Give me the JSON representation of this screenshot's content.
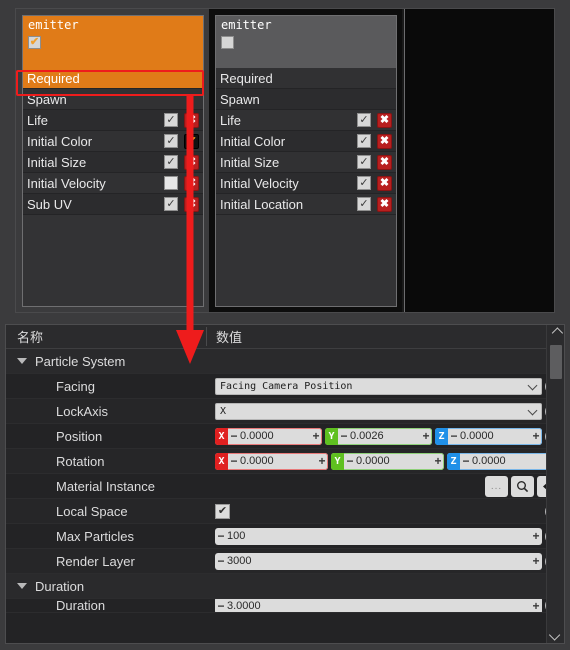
{
  "emitters": [
    {
      "title": "emitter",
      "enabled": true,
      "selected": true,
      "modules": [
        {
          "label": "Required",
          "type": "header-selected",
          "checkbox": null,
          "action": null
        },
        {
          "label": "Spawn",
          "type": "header",
          "checkbox": null,
          "action": null
        },
        {
          "label": "Life",
          "type": "module",
          "checkbox": true,
          "action": "delete-x"
        },
        {
          "label": "Initial Color",
          "type": "module",
          "checkbox": true,
          "action": "color-swatch-check"
        },
        {
          "label": "Initial Size",
          "type": "module",
          "checkbox": true,
          "action": "delete-x"
        },
        {
          "label": "Initial Velocity",
          "type": "module",
          "checkbox": false,
          "action": "delete-x"
        },
        {
          "label": "Sub UV",
          "type": "module",
          "checkbox": true,
          "action": "delete-x"
        }
      ]
    },
    {
      "title": "emitter",
      "enabled": false,
      "selected": false,
      "modules": [
        {
          "label": "Required",
          "type": "header",
          "checkbox": null,
          "action": null
        },
        {
          "label": "Spawn",
          "type": "header",
          "checkbox": null,
          "action": null
        },
        {
          "label": "Life",
          "type": "module",
          "checkbox": true,
          "action": "delete-x"
        },
        {
          "label": "Initial Color",
          "type": "module",
          "checkbox": true,
          "action": "delete-x"
        },
        {
          "label": "Initial Size",
          "type": "module",
          "checkbox": true,
          "action": "delete-x"
        },
        {
          "label": "Initial Velocity",
          "type": "module",
          "checkbox": true,
          "action": "delete-x"
        },
        {
          "label": "Initial Location",
          "type": "module",
          "checkbox": true,
          "action": "delete-x"
        }
      ]
    }
  ],
  "annotation": {
    "highlight_target": "Required",
    "highlight_color": "#ee1c1c",
    "arrow_color": "#ee1c1c",
    "arrow_from": "Required",
    "arrow_to": "Particle System properties"
  },
  "properties": {
    "columns": {
      "name": "名称",
      "value": "数值"
    },
    "groups": [
      {
        "label": "Particle System",
        "expanded": true,
        "rows": [
          {
            "label": "Facing",
            "kind": "combo",
            "value": "Facing Camera Position",
            "reset": "R"
          },
          {
            "label": "LockAxis",
            "kind": "combo",
            "value": "X",
            "reset": "R"
          },
          {
            "label": "Position",
            "kind": "vector3",
            "axes": [
              {
                "axis": "X",
                "value": "0.0000",
                "color": "#e02020"
              },
              {
                "axis": "Y",
                "value": "0.0026",
                "color": "#5fc020"
              },
              {
                "axis": "Z",
                "value": "0.0000",
                "color": "#2090e8"
              }
            ],
            "reset": "R"
          },
          {
            "label": "Rotation",
            "kind": "vector3",
            "axes": [
              {
                "axis": "X",
                "value": "0.0000",
                "color": "#e02020"
              },
              {
                "axis": "Y",
                "value": "0.0000",
                "color": "#5fc020"
              },
              {
                "axis": "Z",
                "value": "0.0000",
                "color": "#2090e8"
              }
            ],
            "reset": null
          },
          {
            "label": "Material Instance",
            "kind": "asset",
            "buttons": [
              "...",
              "search-icon",
              "back-arrow-icon"
            ],
            "reset": null
          },
          {
            "label": "Local Space",
            "kind": "checkbox",
            "value": true,
            "reset": "R"
          },
          {
            "label": "Max Particles",
            "kind": "number",
            "value": "100",
            "reset": "R"
          },
          {
            "label": "Render Layer",
            "kind": "number",
            "value": "3000",
            "reset": "R"
          }
        ]
      },
      {
        "label": "Duration",
        "expanded": true,
        "rows": [
          {
            "label": "Duration",
            "kind": "number",
            "value": "3.0000",
            "reset": "R"
          }
        ]
      }
    ],
    "scrollbar": {
      "up_icon": "chevron-up-icon",
      "down_icon": "chevron-down-icon"
    }
  }
}
